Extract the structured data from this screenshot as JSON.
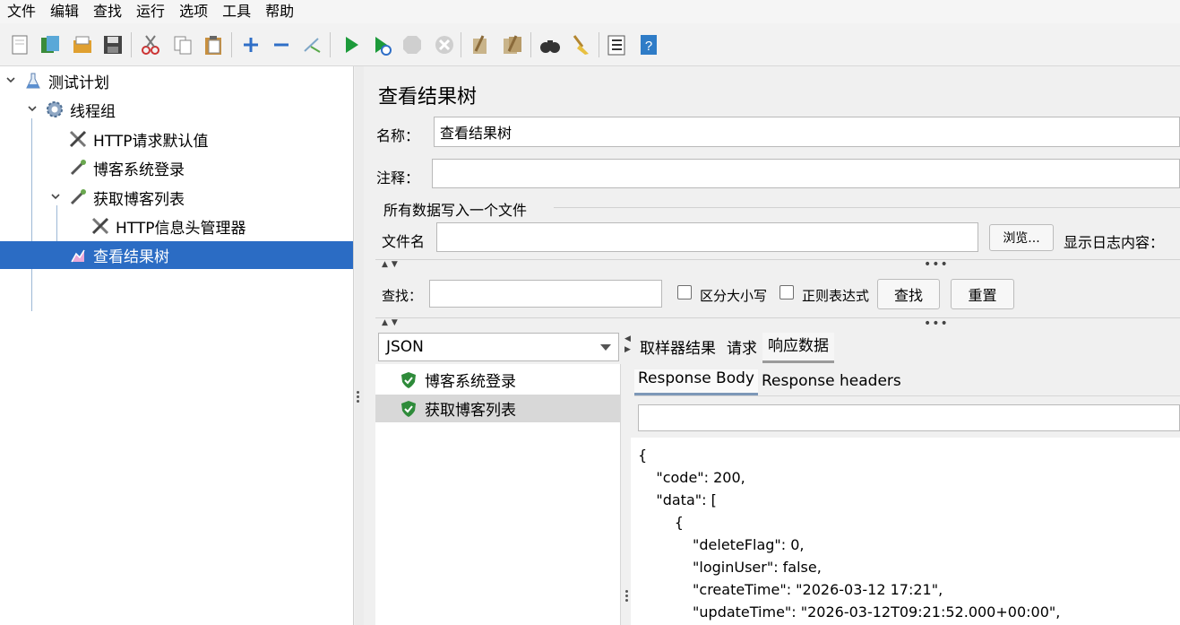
{
  "menu": [
    "文件",
    "编辑",
    "查找",
    "运行",
    "选项",
    "工具",
    "帮助"
  ],
  "toolbar": {
    "icons": [
      "new-icon",
      "templates-icon",
      "open-icon",
      "save-icon",
      "cut-icon",
      "copy-icon",
      "paste-icon",
      "expand-icon",
      "collapse-icon",
      "toggle-icon",
      "start-icon",
      "start-no-timers-icon",
      "stop-icon",
      "shutdown-icon",
      "clear-icon",
      "clear-all-icon",
      "search-icon",
      "reset-search-icon",
      "function-helper-icon",
      "help-icon"
    ]
  },
  "tree": {
    "nodes": [
      {
        "label": "测试计划",
        "icon": "test-plan-icon"
      },
      {
        "label": "线程组",
        "icon": "thread-group-icon"
      },
      {
        "label": "HTTP请求默认值",
        "icon": "config-element-icon"
      },
      {
        "label": "博客系统登录",
        "icon": "sampler-icon"
      },
      {
        "label": "获取博客列表",
        "icon": "sampler-icon"
      },
      {
        "label": "HTTP信息头管理器",
        "icon": "config-element-icon"
      },
      {
        "label": "查看结果树",
        "icon": "listener-icon"
      }
    ]
  },
  "panel": {
    "title": "查看结果树",
    "name_label": "名称：",
    "name_value": "查看结果树",
    "comment_label": "注释：",
    "comment_value": "",
    "file_section_title": "所有数据写入一个文件",
    "filename_label": "文件名",
    "filename_value": "",
    "browse_button": "浏览...",
    "log_label": "显示日志内容：",
    "search_label": "查找：",
    "search_value": "",
    "case_sensitive_label": "区分大小写",
    "regex_label": "正则表达式",
    "find_button": "查找",
    "reset_button": "重置"
  },
  "results": {
    "renderer": "JSON",
    "items": [
      {
        "label": "博客系统登录",
        "status": "success"
      },
      {
        "label": "获取博客列表",
        "status": "success"
      }
    ],
    "tabs": [
      "取样器结果",
      "请求",
      "响应数据"
    ],
    "active_tab": "响应数据",
    "subtabs": [
      "Response Body",
      "Response headers"
    ],
    "active_subtab": "Response Body",
    "body_lines": [
      "{",
      "    \"code\": 200,",
      "    \"data\": [",
      "        {",
      "            \"deleteFlag\": 0,",
      "            \"loginUser\": false,",
      "            \"createTime\": \"2026-03-12 17:21\",",
      "            \"updateTime\": \"2026-03-12T09:21:52.000+00:00\","
    ]
  }
}
